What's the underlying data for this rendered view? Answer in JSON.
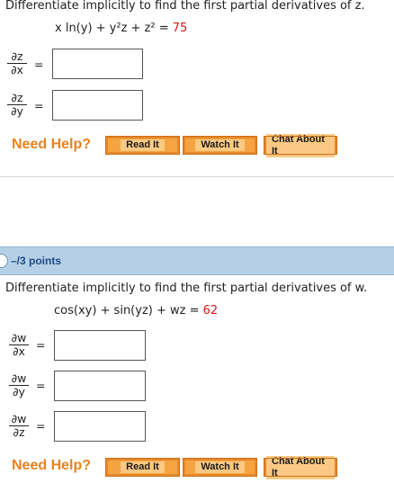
{
  "q1": {
    "prompt": "Differentiate implicitly to find the first partial derivatives of z.",
    "equation_lhs": "x ln(y) + y²z + z² = ",
    "equation_rhs": "75",
    "derivatives": [
      {
        "num": "∂z",
        "den": "∂x"
      },
      {
        "num": "∂z",
        "den": "∂y"
      }
    ],
    "equals": "="
  },
  "q2": {
    "points": "–/3 points",
    "prompt": "Differentiate implicitly to find the first partial derivatives of w.",
    "equation_lhs": "cos(xy) + sin(yz) + wz = ",
    "equation_rhs": "62",
    "derivatives": [
      {
        "num": "∂w",
        "den": "∂x"
      },
      {
        "num": "∂w",
        "den": "∂y"
      },
      {
        "num": "∂w",
        "den": "∂z"
      }
    ],
    "equals": "="
  },
  "help": {
    "label": "Need Help?",
    "read": "Read It",
    "watch": "Watch It",
    "chat": "Chat About It"
  },
  "colors": {
    "help_text": "#e8821f",
    "button": "#f5a441",
    "rhs_value": "#d01818",
    "points_bar": "#b5d0e6"
  }
}
